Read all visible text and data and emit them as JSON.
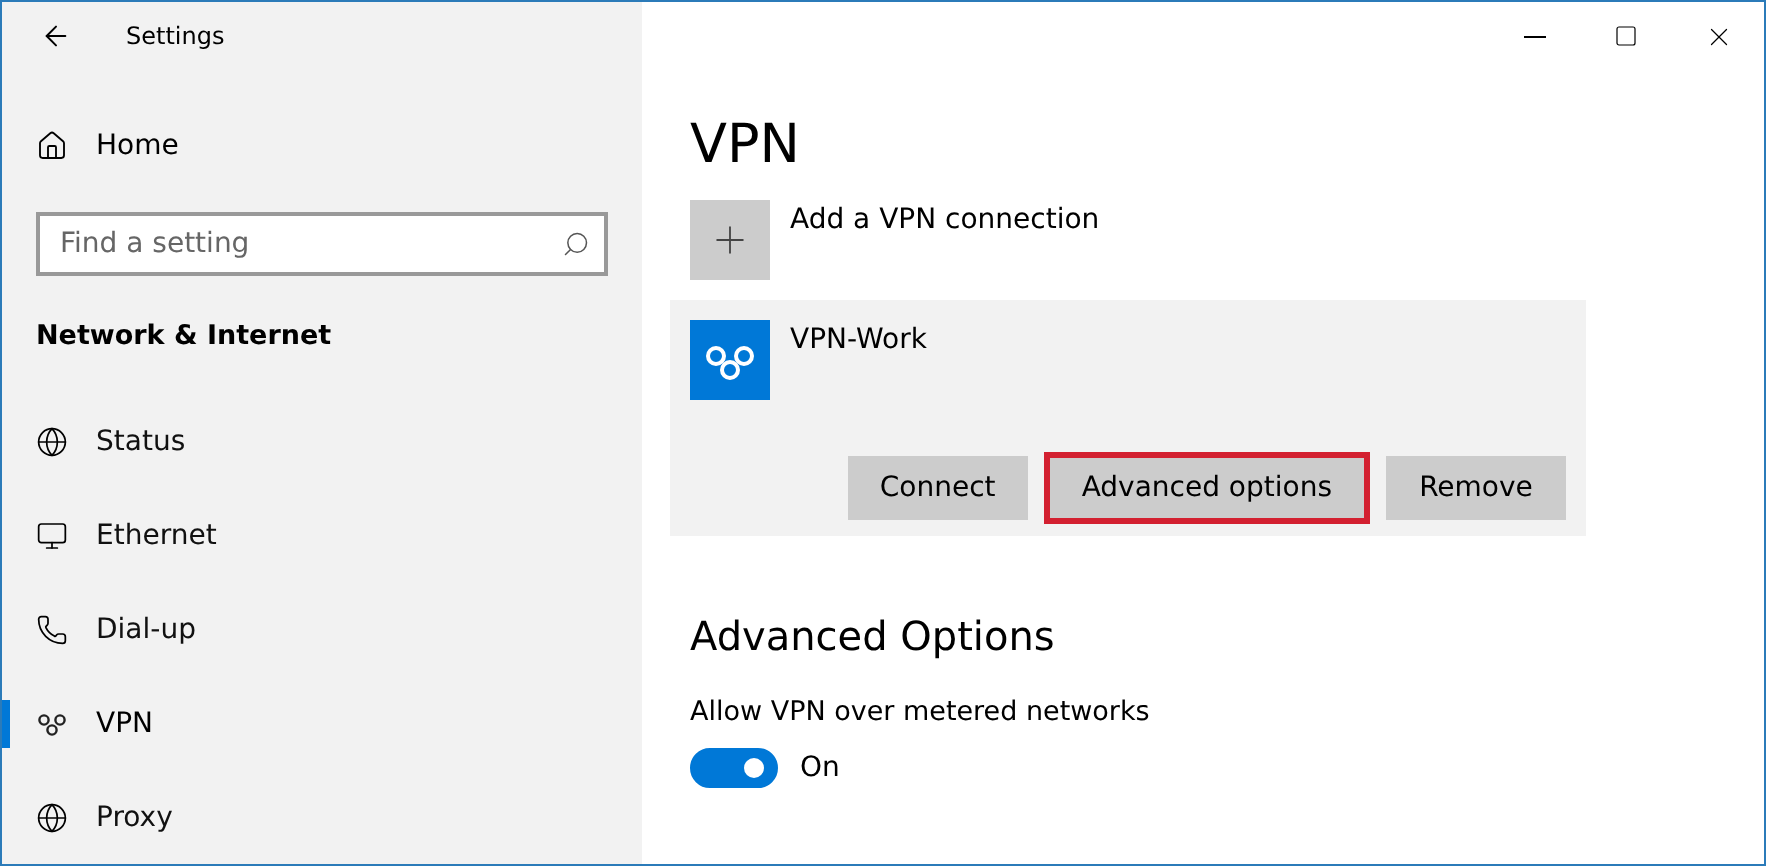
{
  "window": {
    "title": "Settings"
  },
  "sidebar": {
    "home": "Home",
    "search": {
      "placeholder": "Find a setting"
    },
    "section": "Network & Internet",
    "items": [
      {
        "label": "Status",
        "selected": false
      },
      {
        "label": "Ethernet",
        "selected": false
      },
      {
        "label": "Dial-up",
        "selected": false
      },
      {
        "label": "VPN",
        "selected": true
      },
      {
        "label": "Proxy",
        "selected": false
      }
    ]
  },
  "main": {
    "heading": "VPN",
    "add_label": "Add a VPN connection",
    "connection": {
      "name": "VPN-Work",
      "buttons": [
        {
          "label": "Connect",
          "highlighted": false
        },
        {
          "label": "Advanced options",
          "highlighted": true
        },
        {
          "label": "Remove",
          "highlighted": false
        }
      ]
    },
    "advanced_heading": "Advanced Options",
    "metered": {
      "label": "Allow VPN over metered networks",
      "on": true,
      "state_text": "On"
    }
  }
}
